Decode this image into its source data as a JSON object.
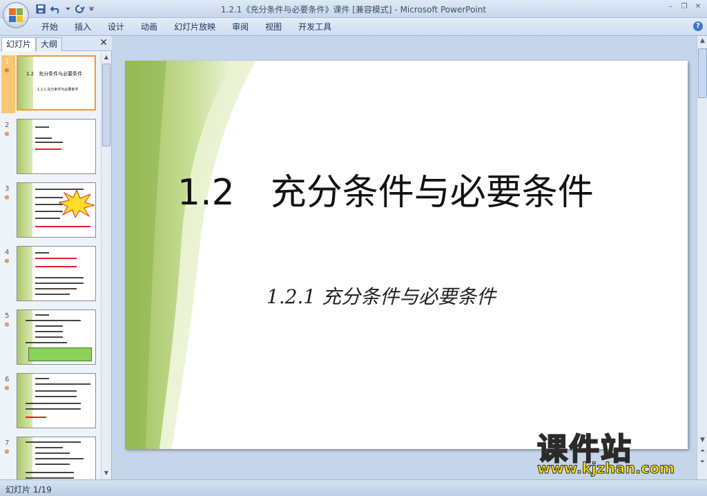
{
  "window": {
    "title": "1.2.1《充分条件与必要条件》课件 [兼容模式] - Microsoft PowerPoint"
  },
  "ribbon": {
    "tabs": [
      "开始",
      "插入",
      "设计",
      "动画",
      "幻灯片放映",
      "审阅",
      "视图",
      "开发工具"
    ]
  },
  "panel": {
    "tab_slides": "幻灯片",
    "tab_outline": "大纲",
    "slides": [
      {
        "num": "1",
        "selected": true
      },
      {
        "num": "2"
      },
      {
        "num": "3"
      },
      {
        "num": "4"
      },
      {
        "num": "5"
      },
      {
        "num": "6"
      },
      {
        "num": "7"
      }
    ]
  },
  "slide": {
    "title": "1.2　充分条件与必要条件",
    "subtitle": "1.2.1  充分条件与必要条件"
  },
  "status": {
    "text": "幻灯片 1/19"
  },
  "watermark": {
    "main": "课件站",
    "url": "www.kjzhan.com"
  },
  "colors": {
    "accent_green": "#a9c96a",
    "selected_slide": "#fbc774",
    "watermark": "#ffe600"
  }
}
